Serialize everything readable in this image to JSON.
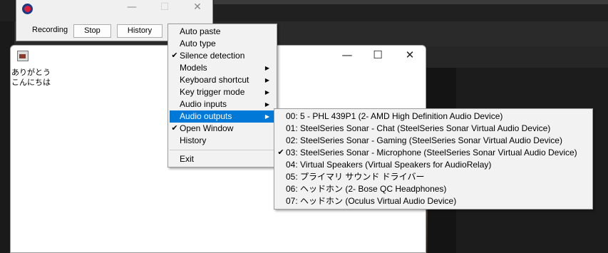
{
  "recorder": {
    "recording_label": "Recording",
    "stop_label": "Stop",
    "history_label": "History",
    "minimize": "—",
    "maximize": "☐",
    "close": "✕"
  },
  "text_window": {
    "lines": [
      "ありがとう",
      "こんにちは"
    ],
    "minimize": "—",
    "maximize": "☐",
    "close": "✕"
  },
  "menu": {
    "items": [
      {
        "label": "Auto paste",
        "checked": false,
        "submenu": false
      },
      {
        "label": "Auto type",
        "checked": false,
        "submenu": false
      },
      {
        "label": "Silence detection",
        "checked": true,
        "submenu": false
      },
      {
        "label": "Models",
        "checked": false,
        "submenu": true
      },
      {
        "label": "Keyboard shortcut",
        "checked": false,
        "submenu": true
      },
      {
        "label": "Key trigger mode",
        "checked": false,
        "submenu": true
      },
      {
        "label": "Audio inputs",
        "checked": false,
        "submenu": true
      },
      {
        "label": "Audio outputs",
        "checked": false,
        "submenu": true,
        "active": true
      },
      {
        "label": "Open Window",
        "checked": true,
        "submenu": false
      },
      {
        "label": "History",
        "checked": false,
        "submenu": false
      },
      {
        "label": "Exit",
        "checked": false,
        "submenu": false
      }
    ],
    "check_glyph": "✔",
    "arrow_glyph": "▶"
  },
  "submenu": {
    "items": [
      {
        "label": "00: 5 - PHL 439P1 (2- AMD High Definition Audio Device)",
        "checked": false
      },
      {
        "label": "01: SteelSeries Sonar - Chat (SteelSeries Sonar Virtual Audio Device)",
        "checked": false
      },
      {
        "label": "02: SteelSeries Sonar - Gaming (SteelSeries Sonar Virtual Audio Device)",
        "checked": false
      },
      {
        "label": "03: SteelSeries Sonar - Microphone (SteelSeries Sonar Virtual Audio Device)",
        "checked": true
      },
      {
        "label": "04: Virtual Speakers (Virtual Speakers for AudioRelay)",
        "checked": false
      },
      {
        "label": "05: プライマリ サウンド ドライバー",
        "checked": false
      },
      {
        "label": "06: ヘッドホン (2- Bose QC Headphones)",
        "checked": false
      },
      {
        "label": "07: ヘッドホン (Oculus Virtual Audio Device)",
        "checked": false
      }
    ]
  },
  "colors": {
    "highlight": "#0078d7",
    "menu_bg": "#f2f2f2"
  }
}
